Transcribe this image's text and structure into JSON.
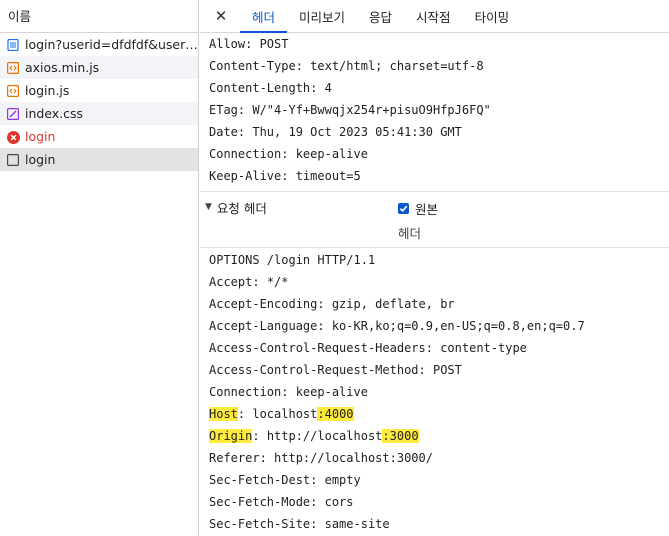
{
  "left_panel": {
    "header": "이름",
    "items": [
      {
        "name": "login?userid=dfdfdf&userpassword=",
        "icon": "document-icon",
        "color": "#1a73e8",
        "status": "normal"
      },
      {
        "name": "axios.min.js",
        "icon": "script-icon",
        "color": "#e37400",
        "status": "normal"
      },
      {
        "name": "login.js",
        "icon": "script-icon",
        "color": "#e37400",
        "status": "normal"
      },
      {
        "name": "index.css",
        "icon": "stylesheet-icon",
        "color": "#9334e6",
        "status": "normal"
      },
      {
        "name": "login",
        "icon": "error-icon",
        "color": "#dc362e",
        "status": "error"
      },
      {
        "name": "login",
        "icon": "blank-file-icon",
        "color": "#474747",
        "status": "selected"
      }
    ]
  },
  "tabs": {
    "close": "✕",
    "items": [
      "헤더",
      "미리보기",
      "응답",
      "시작점",
      "타이밍"
    ],
    "active_index": 0
  },
  "response_headers": [
    {
      "name": "Allow",
      "value": "POST"
    },
    {
      "name": "Content-Type",
      "value": "text/html; charset=utf-8"
    },
    {
      "name": "Content-Length",
      "value": "4"
    },
    {
      "name": "ETag",
      "value": "W/\"4-Yf+Bwwqjx254r+pisuO9HfpJ6FQ\""
    },
    {
      "name": "Date",
      "value": "Thu, 19 Oct 2023 05:41:30 GMT"
    },
    {
      "name": "Connection",
      "value": "keep-alive"
    },
    {
      "name": "Keep-Alive",
      "value": "timeout=5"
    }
  ],
  "request_section": {
    "title": "요청 헤더",
    "raw_label": "원본",
    "raw_checked": true,
    "sub_label": "헤더"
  },
  "request_headers": [
    {
      "text": "OPTIONS /login HTTP/1.1"
    },
    {
      "name": "Accept",
      "value": "*/*"
    },
    {
      "name": "Accept-Encoding",
      "value": "gzip, deflate, br"
    },
    {
      "name": "Accept-Language",
      "value": "ko-KR,ko;q=0.9,en-US;q=0.8,en;q=0.7"
    },
    {
      "name": "Access-Control-Request-Headers",
      "value": "content-type"
    },
    {
      "name": "Access-Control-Request-Method",
      "value": "POST"
    },
    {
      "name": "Connection",
      "value": "keep-alive"
    },
    {
      "name": "Host",
      "value_base": "localhost",
      "value_port": "4000",
      "highlighted": true
    },
    {
      "name": "Origin",
      "value_base": "http://localhost",
      "value_port": "3000",
      "highlighted": true
    },
    {
      "name": "Referer",
      "value": "http://localhost:3000/"
    },
    {
      "name": "Sec-Fetch-Dest",
      "value": "empty"
    },
    {
      "name": "Sec-Fetch-Mode",
      "value": "cors"
    },
    {
      "name": "Sec-Fetch-Site",
      "value": "same-site"
    }
  ],
  "colors": {
    "accent": "#0b57d0",
    "highlight": "#ffeb3b",
    "error": "#dc362e"
  }
}
